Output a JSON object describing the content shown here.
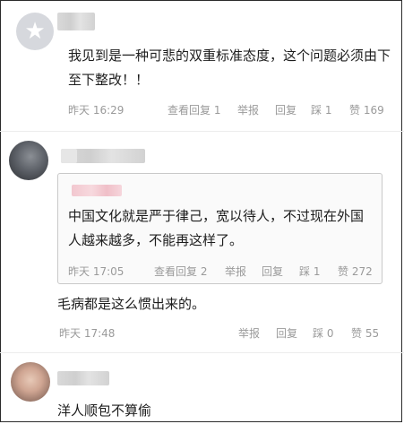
{
  "comments": [
    {
      "text": "我见到是一种可悲的双重标准态度，这个问题必须由下至下整改！！",
      "time": "昨天 16:29",
      "view_replies": "查看回复 1",
      "report": "举报",
      "reply": "回复",
      "dislike": "踩 1",
      "like": "赞 169"
    },
    {
      "quote": {
        "text": "中国文化就是严于律己，宽以待人，不过现在外国人越来越多，不能再这样了。",
        "time": "昨天 17:05",
        "view_replies": "查看回复 2",
        "report": "举报",
        "reply": "回复",
        "dislike": "踩 1",
        "like": "赞 272"
      },
      "text": "毛病都是这么惯出来的。",
      "time": "昨天 17:48",
      "report": "举报",
      "reply": "回复",
      "dislike": "踩 0",
      "like": "赞 55"
    },
    {
      "text": "洋人顺包不算偷"
    }
  ]
}
